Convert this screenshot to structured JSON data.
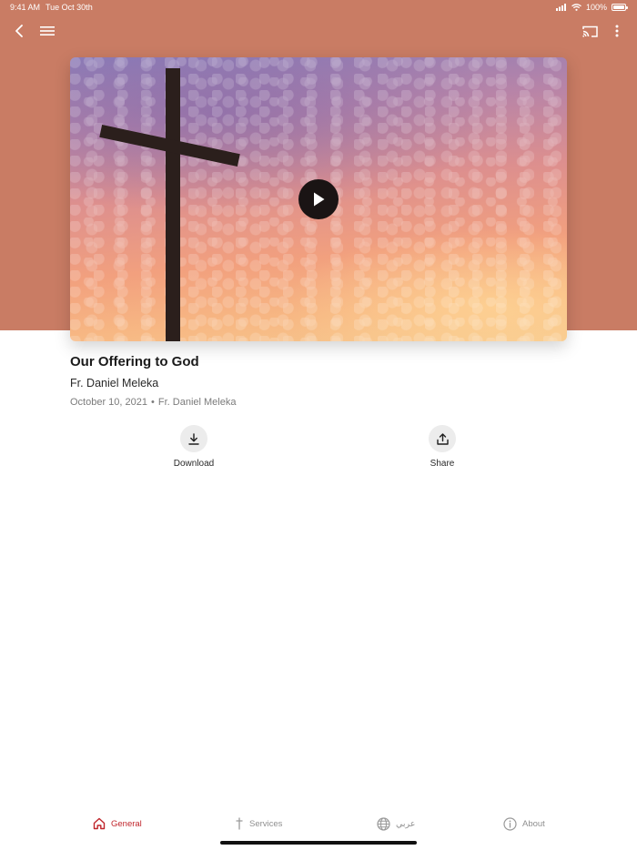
{
  "status_bar": {
    "time": "9:41 AM",
    "date": "Tue Oct 30th",
    "battery": "100%"
  },
  "nav": {
    "back_icon": "chevron-left-icon",
    "menu_icon": "hamburger-icon",
    "cast_icon": "cast-icon",
    "more_icon": "more-vertical-icon"
  },
  "media": {
    "play_icon": "play-icon"
  },
  "sermon": {
    "title": "Our Offering to God",
    "speaker": "Fr. Daniel Meleka",
    "date": "October 10, 2021",
    "separator": "•",
    "meta_speaker": "Fr. Daniel Meleka"
  },
  "actions": {
    "download_label": "Download",
    "share_label": "Share"
  },
  "tabs": [
    {
      "label": "General",
      "icon": "home-icon",
      "active": true
    },
    {
      "label": "Services",
      "icon": "cross-icon",
      "active": false
    },
    {
      "label": "عربي",
      "icon": "globe-icon",
      "active": false
    },
    {
      "label": "About",
      "icon": "info-icon",
      "active": false
    }
  ],
  "colors": {
    "header": "#c97c64",
    "accent": "#c0262c"
  }
}
